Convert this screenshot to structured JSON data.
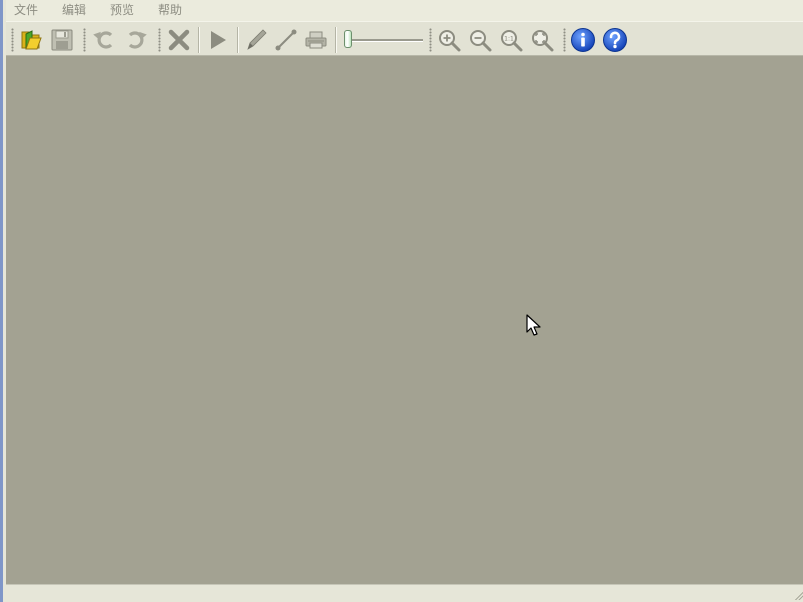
{
  "menubar": {
    "items": [
      {
        "label": "文件"
      },
      {
        "label": "编辑"
      },
      {
        "label": "预览"
      },
      {
        "label": "帮助"
      }
    ]
  },
  "toolbar": {
    "buttons": {
      "open": "folder-open-icon",
      "save": "floppy-disk-icon",
      "undo": "undo-icon",
      "redo": "redo-icon",
      "delete": "delete-x-icon",
      "play": "play-icon",
      "pencil": "pencil-icon",
      "line": "line-tool-icon",
      "printer": "printer-icon",
      "zoom_in": "zoom-in-icon",
      "zoom_out": "zoom-out-icon",
      "zoom_actual": "zoom-1to1-icon",
      "zoom_fit": "zoom-fit-icon",
      "info": "info-icon",
      "help": "help-icon"
    },
    "zoom_slider_level": 0.0,
    "zoom_actual_label": "1:1"
  },
  "colors": {
    "canvas": "#a3a292",
    "toolbar": "#e2e2d4",
    "menu_text": "#8d8d82",
    "info_blue": "#1f5fd8",
    "accent_window_border": "#7f96c8"
  }
}
